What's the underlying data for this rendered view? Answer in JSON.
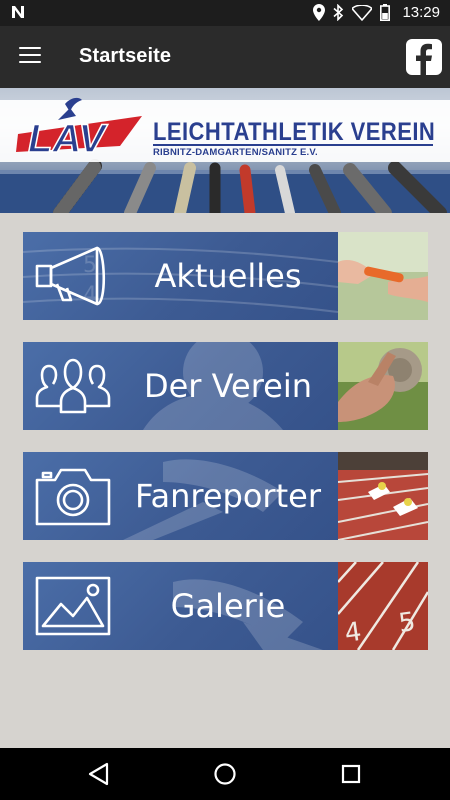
{
  "status_bar": {
    "time": "13:29",
    "icons": [
      "n-logo-icon",
      "location-icon",
      "bluetooth-icon",
      "wifi-icon",
      "battery-icon"
    ]
  },
  "app_bar": {
    "title": "Startseite",
    "menu_icon": "hamburger-menu-icon",
    "facebook_icon": "facebook-icon"
  },
  "banner": {
    "logo_text": "LAV",
    "club_name": "LEICHTATHLETIK VEREIN",
    "subtitle": "RIBNITZ-DAMGARTEN/SANITZ E.V."
  },
  "tiles": [
    {
      "label": "Aktuelles",
      "icon": "megaphone-icon"
    },
    {
      "label": "Der Verein",
      "icon": "people-icon"
    },
    {
      "label": "Fanreporter",
      "icon": "camera-icon"
    },
    {
      "label": "Galerie",
      "icon": "image-icon"
    }
  ],
  "nav_bar": {
    "icons": [
      "back-icon",
      "home-icon",
      "recents-icon"
    ]
  },
  "colors": {
    "tile_blue": "#3d5b93",
    "app_bar": "#2b2b2b",
    "background": "#d6d3cf",
    "brand_blue": "#2a3f8f",
    "brand_red": "#d4232b"
  }
}
